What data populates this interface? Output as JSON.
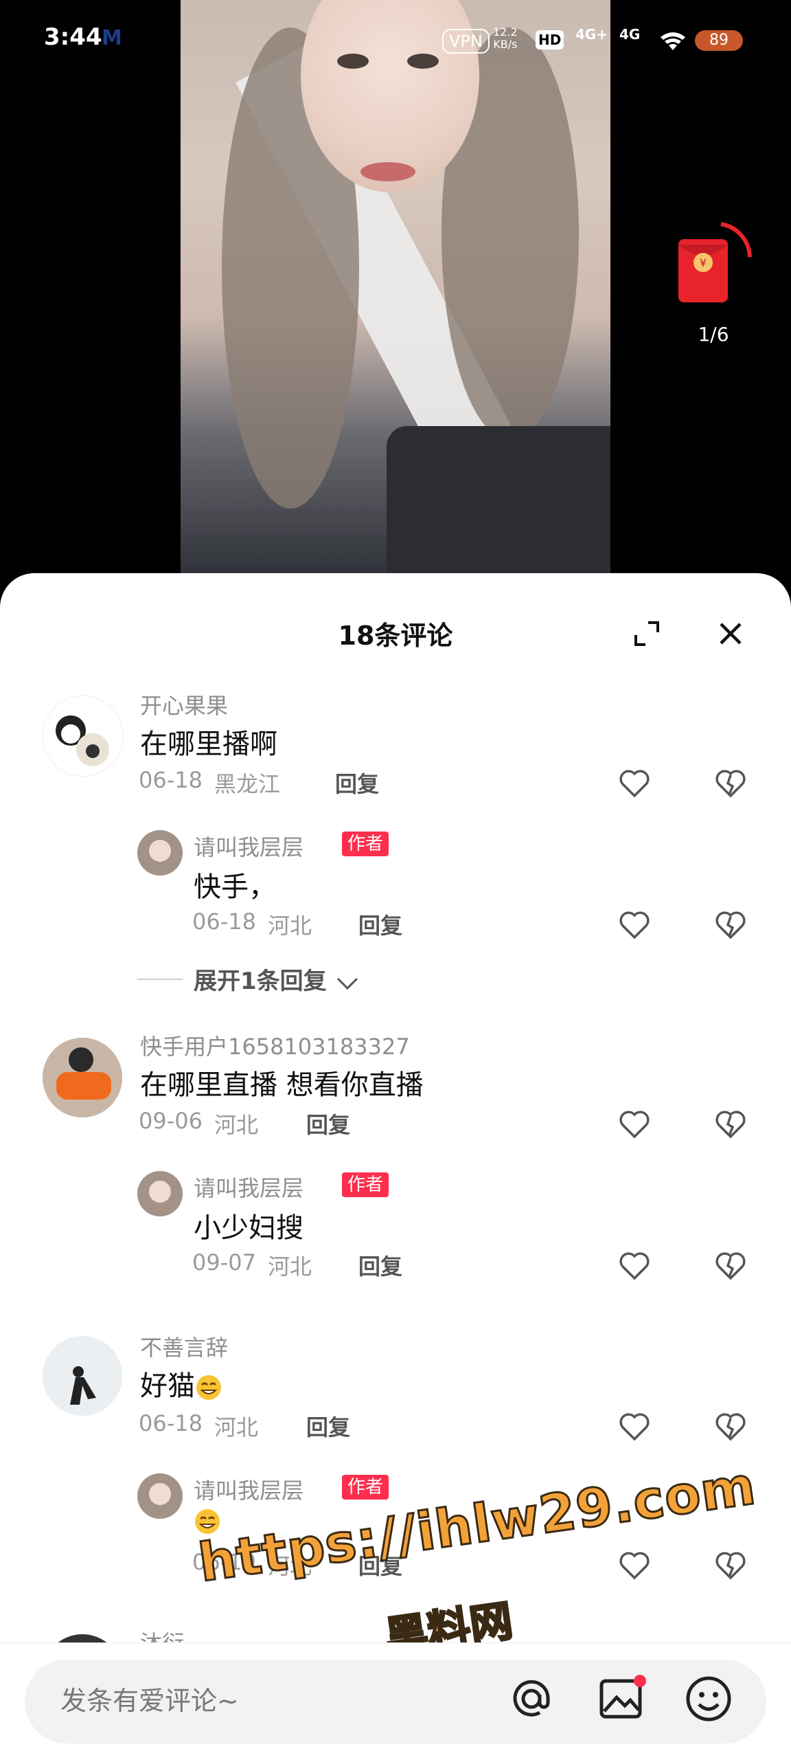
{
  "status_bar": {
    "time": "3:44",
    "app_glyph": "M",
    "vpn": "VPN",
    "net_speed_value": "12.2",
    "net_speed_unit": "KB/s",
    "hd": "HD",
    "sim1": "4G+",
    "sim2": "4G",
    "battery": "89"
  },
  "red_packet": {
    "count": "1/6"
  },
  "sheet": {
    "title": "18条评论"
  },
  "comments": [
    {
      "username": "开心果果",
      "text": "在哪里播啊",
      "date": "06-18",
      "location": "黑龙江",
      "reply_label": "回复",
      "replies": [
        {
          "username": "请叫我层层",
          "badge": "作者",
          "text": "快手，",
          "date": "06-18",
          "location": "河北",
          "reply_label": "回复"
        }
      ],
      "expand_label": "展开1条回复"
    },
    {
      "username": "快手用户1658103183327",
      "text": "在哪里直播 想看你直播",
      "date": "09-06",
      "location": "河北",
      "reply_label": "回复",
      "replies": [
        {
          "username": "请叫我层层",
          "badge": "作者",
          "text": "小少妇搜",
          "date": "09-07",
          "location": "河北",
          "reply_label": "回复"
        }
      ]
    },
    {
      "username": "不善言辞",
      "text": "好猫",
      "date": "06-18",
      "location": "河北",
      "reply_label": "回复",
      "replies": [
        {
          "username": "请叫我层层",
          "badge": "作者",
          "text": "",
          "date": "06-19",
          "location": "河北",
          "reply_label": "回复"
        }
      ]
    },
    {
      "username": "沐衍"
    }
  ],
  "input": {
    "placeholder": "发条有爱评论~"
  },
  "watermark": {
    "url": "https://ihlw29.com",
    "name": "黑料网"
  },
  "colors": {
    "author_badge": "#ff2e4d",
    "red_packet": "#e8232b",
    "watermark": "#f3a23a"
  },
  "icons": [
    "expand-icon",
    "close-icon",
    "heart-icon",
    "dislike-heart-icon",
    "chevron-down-icon",
    "at-icon",
    "image-icon",
    "emoji-icon",
    "wifi-icon",
    "red-packet-icon",
    "grin-emoji-icon"
  ]
}
